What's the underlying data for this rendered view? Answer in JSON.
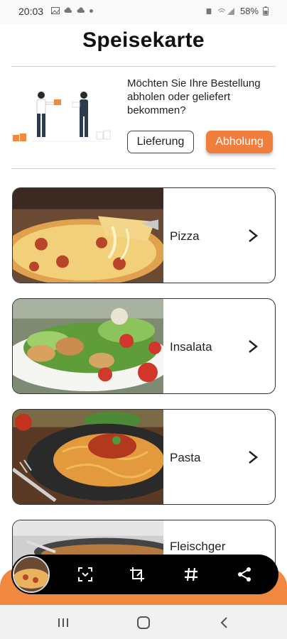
{
  "status_bar": {
    "time": "20:03",
    "battery": "58%"
  },
  "header": {
    "title": "Speisekarte"
  },
  "order_choice": {
    "question": "Möchten Sie Ihre Bestellung abholen oder geliefert bekommen?",
    "delivery_label": "Lieferung",
    "pickup_label": "Abholung",
    "accent_color": "#f07f3c"
  },
  "menu": {
    "items": [
      {
        "label": "Pizza",
        "image": "pizza-photo"
      },
      {
        "label": "Insalata",
        "image": "salad-photo"
      },
      {
        "label": "Pasta",
        "image": "pasta-photo"
      },
      {
        "label": "Fleischger",
        "image": "meat-dish-photo"
      }
    ]
  },
  "toolbar": {
    "icons": [
      "scan-icon",
      "crop-icon",
      "hashtag-icon",
      "share-icon"
    ]
  },
  "system_nav": {
    "icons": [
      "recent-apps-icon",
      "home-icon",
      "back-icon"
    ]
  }
}
